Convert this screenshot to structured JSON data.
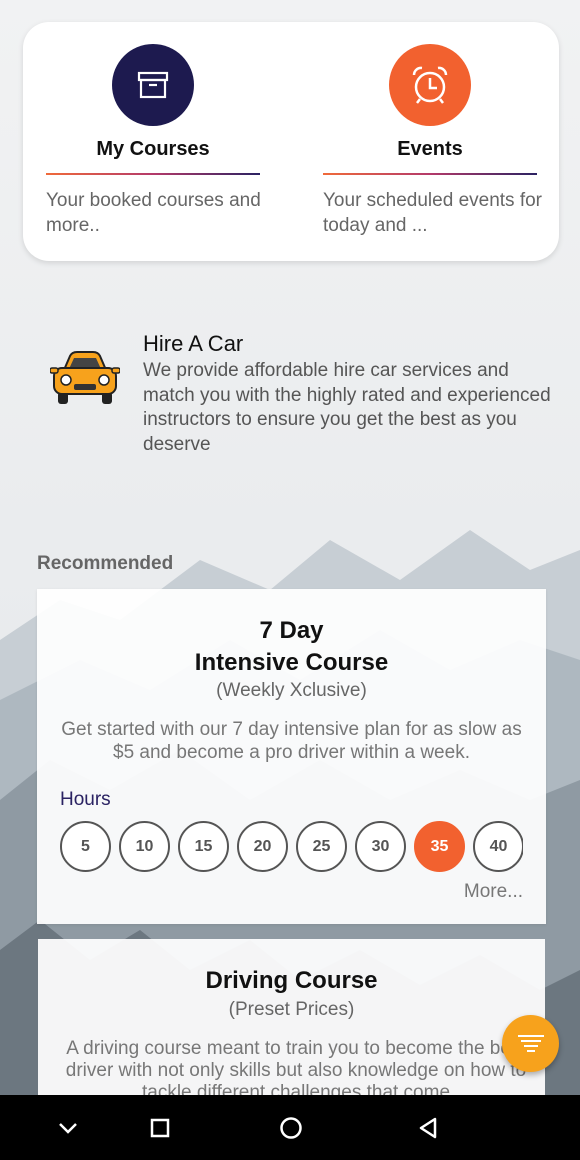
{
  "top_tiles": {
    "courses": {
      "title": "My Courses",
      "description": "Your booked courses and more..",
      "icon": "archive-box-icon",
      "color": "#1d1a4f"
    },
    "events": {
      "title": "Events",
      "description": "Your scheduled events for today and ...",
      "icon": "alarm-clock-icon",
      "color": "#f2612f"
    }
  },
  "hire_car": {
    "title": "Hire A Car",
    "description": "We provide affordable hire car services and match you with the highly rated and experienced instructors to ensure you get the best as you deserve",
    "icon": "car-icon"
  },
  "recommended_label": "Recommended",
  "course_cards": [
    {
      "title_line1": "7 Day",
      "title_line2": "Intensive Course",
      "subtitle": "(Weekly Xclusive)",
      "description": "Get started with our 7 day intensive plan for as slow as $5 and become a pro driver within a week.",
      "hours_label": "Hours",
      "hours": [
        "5",
        "10",
        "15",
        "20",
        "25",
        "30",
        "35",
        "40"
      ],
      "selected_hour": "35",
      "more_label": "More..."
    },
    {
      "title": "Driving Course",
      "subtitle": "(Preset Prices)",
      "description": "A driving course meant to train you to become the best driver with not only skills but also knowledge on how to tackle different challenges that come"
    }
  ],
  "fab": {
    "icon": "filter-icon",
    "color": "#f7a21c"
  },
  "nav_bar": {
    "icons": [
      "chevron-down-icon",
      "square-icon",
      "circle-icon",
      "back-triangle-icon"
    ]
  }
}
